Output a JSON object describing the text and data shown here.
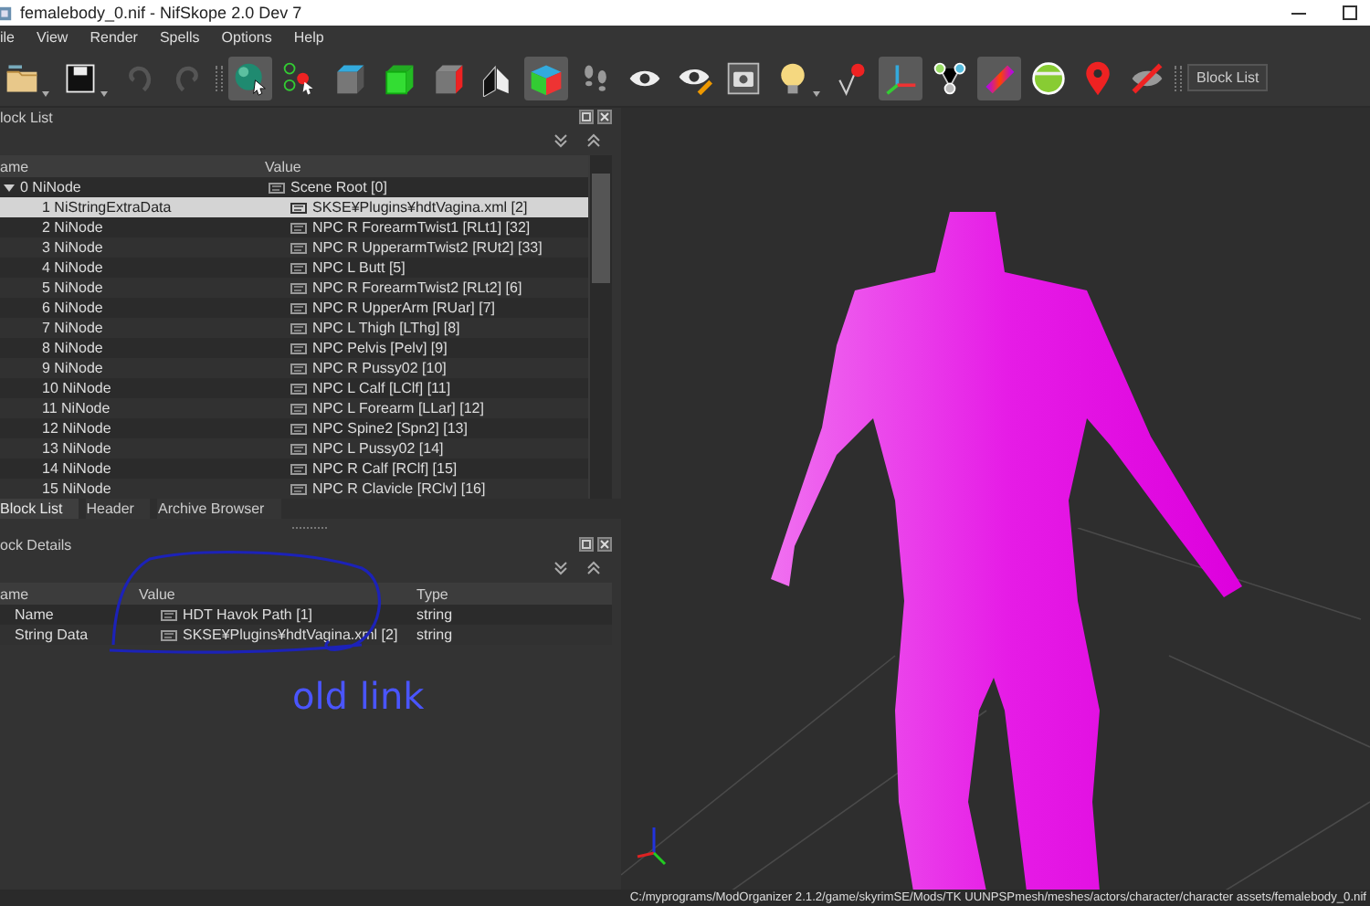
{
  "window": {
    "title": "femalebody_0.nif - NifSkope 2.0 Dev 7"
  },
  "menu": [
    "ile",
    "View",
    "Render",
    "Spells",
    "Options",
    "Help"
  ],
  "toolbar": {
    "buttons": [
      {
        "kind": "open",
        "pressed": false,
        "dropdown": true
      },
      {
        "kind": "save",
        "pressed": false,
        "dropdown": true
      },
      {
        "kind": "undo",
        "pressed": false,
        "dropdown": false
      },
      {
        "kind": "redo",
        "pressed": false,
        "dropdown": false
      },
      {
        "kind": "sphere",
        "pressed": true,
        "dropdown": false
      },
      {
        "kind": "nodes",
        "pressed": false,
        "dropdown": false
      },
      {
        "kind": "cube-top",
        "pressed": false,
        "dropdown": false
      },
      {
        "kind": "cube-front",
        "pressed": false,
        "dropdown": false
      },
      {
        "kind": "cube-side",
        "pressed": false,
        "dropdown": false
      },
      {
        "kind": "planes",
        "pressed": false,
        "dropdown": false
      },
      {
        "kind": "cube-color",
        "pressed": true,
        "dropdown": false
      },
      {
        "kind": "footprints",
        "pressed": false,
        "dropdown": false
      },
      {
        "kind": "eye",
        "pressed": false,
        "dropdown": false
      },
      {
        "kind": "eye-pencil",
        "pressed": false,
        "dropdown": false
      },
      {
        "kind": "camera",
        "pressed": false,
        "dropdown": false
      },
      {
        "kind": "bulb",
        "pressed": false,
        "dropdown": true
      },
      {
        "kind": "pin",
        "pressed": false,
        "dropdown": false
      },
      {
        "kind": "axes",
        "pressed": true,
        "dropdown": false
      },
      {
        "kind": "graph",
        "pressed": false,
        "dropdown": false
      },
      {
        "kind": "gradient",
        "pressed": true,
        "dropdown": false
      },
      {
        "kind": "dial",
        "pressed": false,
        "dropdown": false
      },
      {
        "kind": "marker",
        "pressed": false,
        "dropdown": false
      },
      {
        "kind": "eye-off",
        "pressed": false,
        "dropdown": false
      }
    ],
    "block_list_button": "Block List"
  },
  "block_list": {
    "title": "lock List",
    "columns": [
      "ame",
      "Value"
    ],
    "rows": [
      {
        "name": "0 NiNode",
        "value": "Scene Root [0]",
        "selected": false,
        "expanded": true,
        "children": [
          {
            "name": "1 NiStringExtraData",
            "value": "SKSE¥Plugins¥hdtVagina.xml [2]",
            "selected": true
          },
          {
            "name": "2 NiNode",
            "value": "NPC R ForearmTwist1 [RLt1] [32]",
            "selected": false
          },
          {
            "name": "3 NiNode",
            "value": "NPC R UpperarmTwist2 [RUt2] [33]",
            "selected": false
          },
          {
            "name": "4 NiNode",
            "value": "NPC L Butt [5]",
            "selected": false
          },
          {
            "name": "5 NiNode",
            "value": "NPC R ForearmTwist2 [RLt2] [6]",
            "selected": false
          },
          {
            "name": "6 NiNode",
            "value": "NPC R UpperArm [RUar] [7]",
            "selected": false
          },
          {
            "name": "7 NiNode",
            "value": "NPC L Thigh [LThg] [8]",
            "selected": false
          },
          {
            "name": "8 NiNode",
            "value": "NPC Pelvis [Pelv] [9]",
            "selected": false
          },
          {
            "name": "9 NiNode",
            "value": "NPC R Pussy02 [10]",
            "selected": false
          },
          {
            "name": "10 NiNode",
            "value": "NPC L Calf [LClf] [11]",
            "selected": false
          },
          {
            "name": "11 NiNode",
            "value": "NPC L Forearm [LLar] [12]",
            "selected": false
          },
          {
            "name": "12 NiNode",
            "value": "NPC Spine2 [Spn2] [13]",
            "selected": false
          },
          {
            "name": "13 NiNode",
            "value": "NPC L Pussy02 [14]",
            "selected": false
          },
          {
            "name": "14 NiNode",
            "value": "NPC R Calf [RClf] [15]",
            "selected": false
          },
          {
            "name": "15 NiNode",
            "value": "NPC R Clavicle [RClv] [16]",
            "selected": false
          }
        ]
      }
    ]
  },
  "tabs": [
    {
      "label": "Block List",
      "selected": true
    },
    {
      "label": "Header",
      "selected": false
    },
    {
      "label": "Archive Browser",
      "selected": false
    }
  ],
  "block_details": {
    "title": "ock Details",
    "columns": [
      "ame",
      "Value",
      "Type"
    ],
    "rows": [
      {
        "name": "Name",
        "value": "HDT Havok Path [1]",
        "type": "string"
      },
      {
        "name": "String Data",
        "value": "SKSE¥Plugins¥hdtVagina.xml [2]",
        "type": "string"
      }
    ]
  },
  "annotation": {
    "text": "old link"
  },
  "status_bar": "C:/myprograms/ModOrganizer 2.1.2/game/skyrimSE/Mods/TK UUNPSPmesh/meshes/actors/character/character assets/femalebody_0.nif"
}
